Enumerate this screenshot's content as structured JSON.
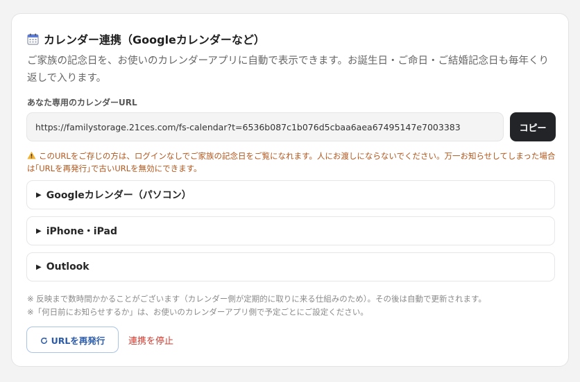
{
  "header": {
    "icon": "calendar-icon",
    "title": "カレンダー連携（Googleカレンダーなど）"
  },
  "description": "ご家族の記念日を、お使いのカレンダーアプリに自動で表示できます。お誕生日・ご命日・ご結婚記念日も毎年くり返しで入ります。",
  "url_section": {
    "label": "あなた専用のカレンダーURL",
    "url_value": "https://familystorage.21ces.com/fs-calendar?t=6536b087c1b076d5cbaa6aea67495147e7003383",
    "copy_label": "コピー"
  },
  "warning": {
    "icon": "warning-icon",
    "text": "このURLをご存じの方は、ログインなしでご家族の記念日をご覧になれます。人にお渡しにならないでください。万一お知らせしてしまった場合は｢URLを再発行｣で古いURLを無効にできます。"
  },
  "accordions": [
    {
      "arrow": "▶",
      "label": "Googleカレンダー（パソコン）"
    },
    {
      "arrow": "▶",
      "label": "iPhone・iPad"
    },
    {
      "arrow": "▶",
      "label": "Outlook"
    }
  ],
  "notes": [
    "※ 反映まで数時間かかることがございます（カレンダー側が定期的に取りに来る仕組みのため）。その後は自動で更新されます。",
    "※「何日前にお知らせするか」は、お使いのカレンダーアプリ側で予定ごとにご設定ください。"
  ],
  "actions": {
    "reissue_icon": "refresh-icon",
    "reissue_label": "URLを再発行",
    "stop_label": "連携を停止"
  },
  "colors": {
    "warning": "#b2561c",
    "primary_button": "#222428",
    "link_blue": "#2a5aa8",
    "danger": "#d23a2e"
  }
}
